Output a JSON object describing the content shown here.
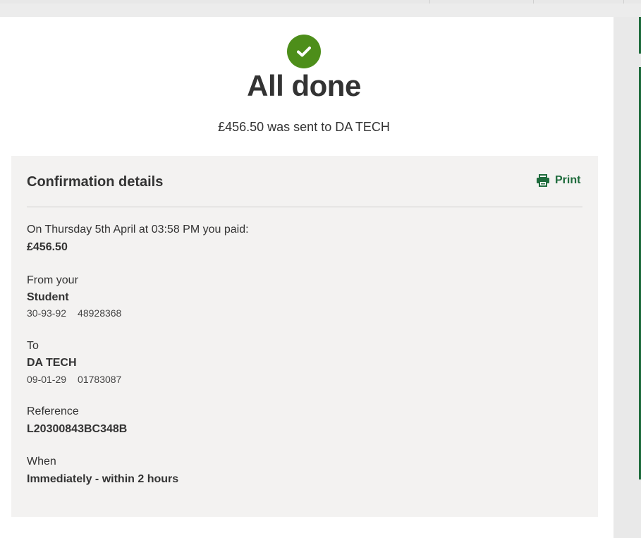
{
  "page": {
    "title": "All done",
    "subtitle": "£456.50 was sent to DA TECH"
  },
  "details": {
    "heading": "Confirmation details",
    "print_label": "Print",
    "paid_line": "On Thursday 5th April at 03:58 PM you paid:",
    "amount": "£456.50",
    "from_label": "From your",
    "from_account_name": "Student",
    "from_sort_code": "30-93-92",
    "from_account_number": "48928368",
    "to_label": "To",
    "to_name": "DA TECH",
    "to_sort_code": "09-01-29",
    "to_account_number": "01783087",
    "reference_label": "Reference",
    "reference_value": "L20300843BC348B",
    "when_label": "When",
    "when_value": "Immediately - within 2 hours"
  },
  "icons": {
    "success": "check-icon",
    "print": "printer-icon"
  },
  "colors": {
    "success_green": "#4d8e1a",
    "brand_green": "#1e6b3c",
    "panel_bg": "#f3f2f1"
  }
}
